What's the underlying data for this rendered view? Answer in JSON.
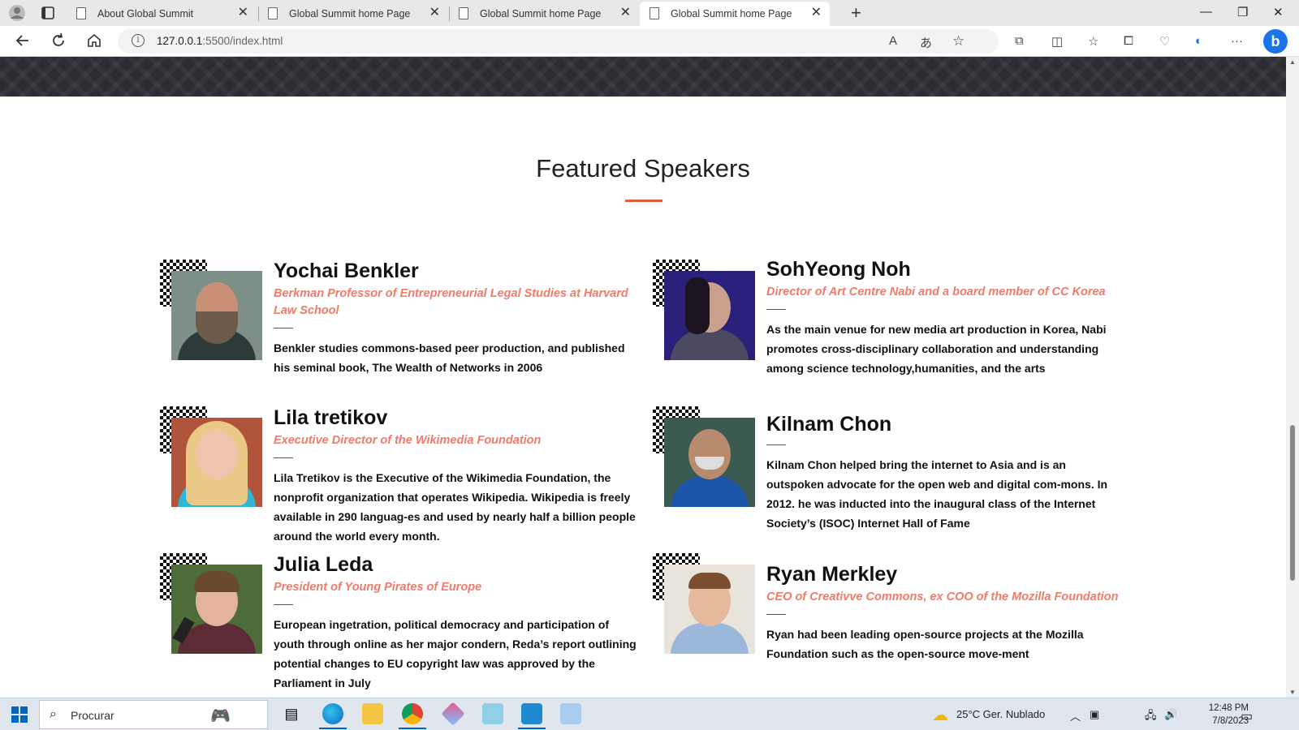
{
  "browser": {
    "tabs": [
      {
        "label": "About Global Summit",
        "active": false
      },
      {
        "label": "Global Summit home Page",
        "active": false
      },
      {
        "label": "Global Summit home Page",
        "active": false
      },
      {
        "label": "Global Summit home Page",
        "active": true
      }
    ],
    "url_host": "127.0.0.1",
    "url_rest": ":5500/index.html"
  },
  "section": {
    "title": "Featured Speakers",
    "accent_color": "#e25b3d"
  },
  "speakers": [
    {
      "name": "Yochai Benkler",
      "role": "Berkman Professor of Entrepreneurial Legal Studies at Harvard Law School",
      "description": "Benkler studies commons-based peer production, and published his seminal book, The Wealth of Networks in 2006"
    },
    {
      "name": "SohYeong Noh",
      "role": "Director of Art Centre Nabi and a board member of CC Korea",
      "description": "As the main venue for new media art production in Korea, Nabi promotes cross-disciplinary collaboration and understanding among science technology,humanities, and the arts"
    },
    {
      "name": "Lila tretikov",
      "role": "Executive Director of the Wikimedia Foundation",
      "description": "Lila Tretikov is the Executive of the Wikimedia Foundation, the nonprofit organization that operates Wikipedia. Wikipedia is freely available in 290 languag-es and used by nearly half a billion people around the world every month."
    },
    {
      "name": "Kilnam Chon",
      "role": "",
      "description": "Kilnam Chon helped bring the internet to Asia and is an outspoken advocate for the open web and digital com-mons. In 2012. he was inducted into the inaugural class of the Internet Society’s (ISOC) Internet Hall of Fame"
    },
    {
      "name": "Julia Leda",
      "role": "President of Young Pirates of Europe",
      "description": "European ingetration, political democracy and participation of youth through online as her major condern, Reda’s report outlining potential changes to EU copyright law was approved by the Parliament in July"
    },
    {
      "name": "Ryan Merkley",
      "role": "CEO of Creativve Commons, ex COO of the Mozilla Foundation",
      "description": "Ryan had been leading open-source projects at the Mozilla Foundation such as the open-source move-ment"
    }
  ],
  "taskbar": {
    "search_placeholder": "Procurar",
    "weather": "25°C  Ger. Nublado",
    "time": "12:48 PM",
    "date": "7/8/2023"
  },
  "colors": {
    "role_text": "#f07b6a",
    "banner": "#2b2d33"
  }
}
